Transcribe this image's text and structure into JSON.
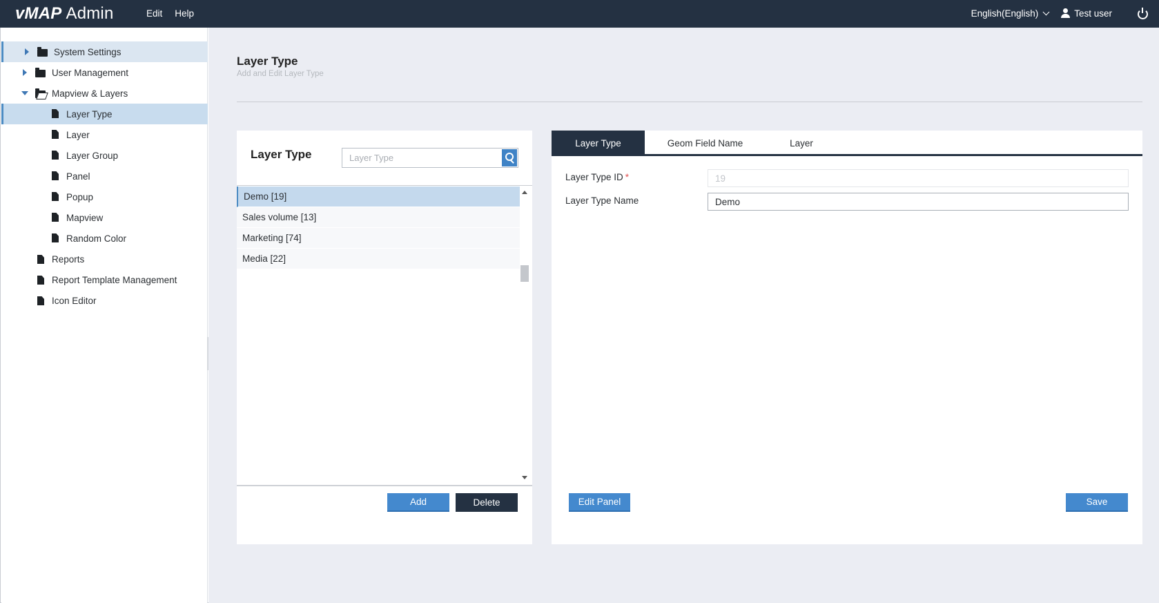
{
  "brand": {
    "name": "vMAP",
    "suffix": "Admin"
  },
  "topmenu": {
    "edit": "Edit",
    "help": "Help"
  },
  "topright": {
    "language": "English(English)",
    "user": "Test user"
  },
  "sidebar": {
    "items": [
      {
        "label": "System Settings"
      },
      {
        "label": "User Management"
      },
      {
        "label": "Mapview & Layers"
      },
      {
        "label": "Layer Type"
      },
      {
        "label": "Layer"
      },
      {
        "label": "Layer Group"
      },
      {
        "label": "Panel"
      },
      {
        "label": "Popup"
      },
      {
        "label": "Mapview"
      },
      {
        "label": "Random Color"
      },
      {
        "label": "Reports"
      },
      {
        "label": "Report Template Management"
      },
      {
        "label": "Icon Editor"
      }
    ]
  },
  "page": {
    "title": "Layer Type",
    "subtitle": "Add and Edit Layer Type"
  },
  "list_panel": {
    "title": "Layer Type",
    "search_placeholder": "Layer Type",
    "rows": [
      {
        "label": "Demo [19]"
      },
      {
        "label": "Sales volume  [13]"
      },
      {
        "label": "Marketing  [74]"
      },
      {
        "label": "Media  [22]"
      }
    ],
    "add_label": "Add",
    "delete_label": "Delete"
  },
  "detail_panel": {
    "tabs": [
      {
        "label": "Layer Type"
      },
      {
        "label": "Geom Field Name"
      },
      {
        "label": "Layer"
      }
    ],
    "fields": {
      "id_label": "Layer Type ID",
      "id_required": "*",
      "id_value": "19",
      "name_label": "Layer Type Name",
      "name_value": "Demo"
    },
    "edit_panel_label": "Edit Panel",
    "save_label": "Save"
  },
  "colors": {
    "topbar": "#243142",
    "accent": "#4489ce",
    "selection": "#c8dcee",
    "background": "#ebedf3"
  }
}
